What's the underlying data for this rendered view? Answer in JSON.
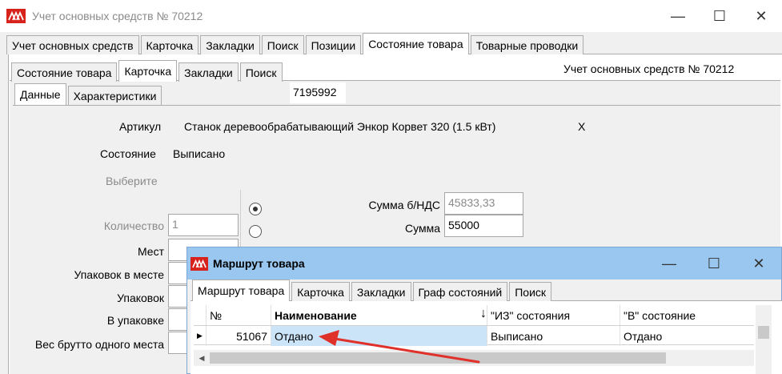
{
  "window": {
    "title": "Учет основных средств № 70212",
    "minimize": "—",
    "maximize": "☐",
    "close": "✕"
  },
  "main_tabs": [
    "Учет основных средств",
    "Карточка",
    "Закладки",
    "Поиск",
    "Позиции",
    "Состояние товара",
    "Товарные проводки"
  ],
  "sub_tabs": [
    "Состояние товара",
    "Карточка",
    "Закладки",
    "Поиск"
  ],
  "card_tabs": [
    "Данные",
    "Характеристики"
  ],
  "header_right": "Учет основных средств № 70212",
  "card": {
    "id": "7195992",
    "article_label": "Артикул",
    "article_value": "Станок деревообрабатывающий Энкор Корвет 320 (1.5 кВт)",
    "x_mark": "X",
    "state_label": "Состояние",
    "state_value": "Выписано",
    "choose_label": "Выберите",
    "quantity_label": "Количество",
    "quantity_value": "1",
    "places_label": "Мест",
    "packs_in_place_label": "Упаковок в месте",
    "packs_label": "Упаковок",
    "in_pack_label": "В упаковке",
    "gross_label": "Вес брутто одного места",
    "sum_no_vat_label": "Сумма  б/НДС",
    "sum_no_vat_value": "45833,33",
    "sum_label": "Сумма",
    "sum_value": "55000"
  },
  "popup": {
    "title": "Маршрут товара",
    "minimize": "—",
    "maximize": "☐",
    "close": "✕",
    "tabs": [
      "Маршрут товара",
      "Карточка",
      "Закладки",
      "Граф состояний",
      "Поиск"
    ],
    "columns": [
      "№",
      "Наименование",
      "\"ИЗ\" состояния",
      "\"В\" состояние"
    ],
    "rows": [
      {
        "marker": "▶",
        "num": "51067",
        "name": "Отдано",
        "from": "Выписано",
        "to": "Отдано"
      }
    ],
    "sort_arrow": "↓"
  },
  "colors": {
    "accent_logo": "#d8231c",
    "popup_title_bg": "#99c7ef",
    "selection": "#cce4f7",
    "annotation_arrow": "#e0302a"
  }
}
